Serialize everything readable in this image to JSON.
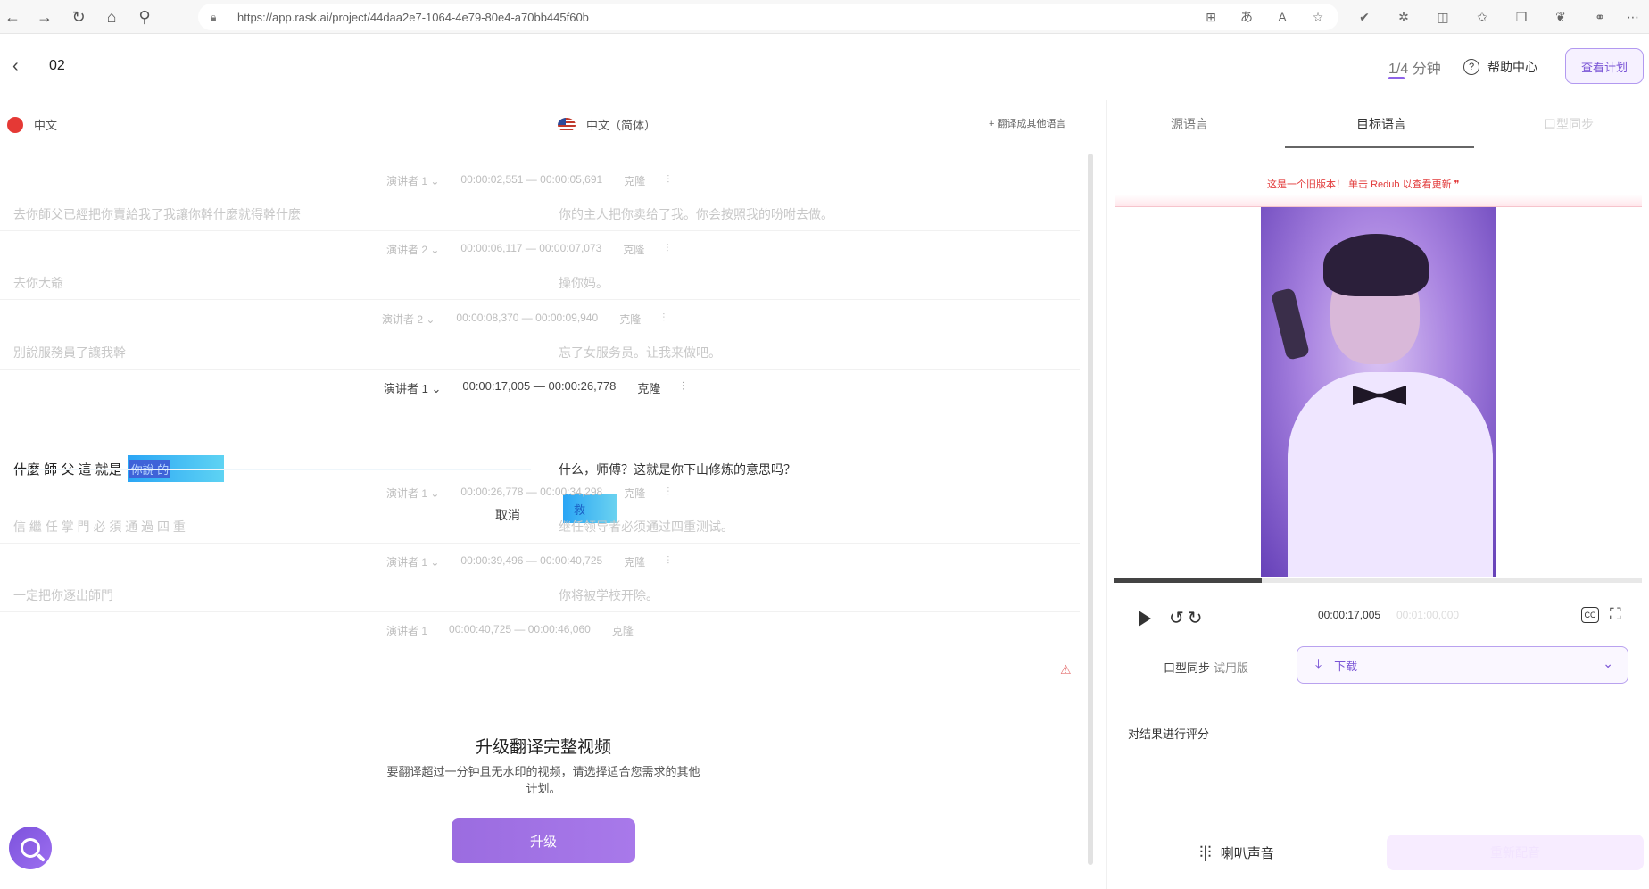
{
  "browser": {
    "url": "https://app.rask.ai/project/44daa2e7-1064-4e79-80e4-a70bb445f60b"
  },
  "header": {
    "project_title": "02",
    "minutes_used": "1/4 分钟",
    "help_label": "帮助中心",
    "plan_button": "查看计划"
  },
  "languages": {
    "source": "中文",
    "target": "中文（简体）",
    "translate_other": "+ 翻译成其他语言"
  },
  "segments": [
    {
      "speaker": "演讲者 1 ⌄",
      "time": "00:00:02,551 — 00:00:05,691",
      "clone": "克隆",
      "source": "去你師父已經把你賣給我了我讓你幹什麼就得幹什麼",
      "target": "你的主人把你卖给了我。你会按照我的吩咐去做。"
    },
    {
      "speaker": "演讲者 2 ⌄",
      "time": "00:00:06,117 — 00:00:07,073",
      "clone": "克隆",
      "source": "去你大爺",
      "target": "操你妈。"
    },
    {
      "speaker": "演讲者 2 ⌄",
      "time": "00:00:08,370 — 00:00:09,940",
      "clone": "克隆",
      "source": "別說服務員了讓我幹",
      "target": "忘了女服务员。让我来做吧。"
    },
    {
      "speaker": "演讲者 1 ⌄",
      "time": "00:00:26,778 — 00:00:34,298",
      "clone": "克隆",
      "source": "信 繼 任 掌 門 必 須 通 過 四 重",
      "target": "继任领导者必须通过四重测试。"
    },
    {
      "speaker": "演讲者 1 ⌄",
      "time": "00:00:39,496 — 00:00:40,725",
      "clone": "克隆",
      "source": "一定把你逐出師門",
      "target": "你将被学校开除。"
    },
    {
      "speaker": "演讲者 1",
      "time": "00:00:40,725 — 00:00:46,060",
      "clone": "克隆"
    }
  ],
  "active_segment": {
    "speaker": "演讲者 1 ⌄",
    "time": "00:00:17,005 — 00:00:26,778",
    "clone": "克隆",
    "source_text": "什麼 師 父 這 就是",
    "source_selected": "你說 的",
    "target": "什么，师傅？这就是你下山修炼的意思吗？",
    "cancel_label": "取消",
    "save_label": "救"
  },
  "upgrade": {
    "title": "升级翻译完整视频",
    "description": "要翻译超过一分钟且无水印的视频，请选择适合您需求的其他计划。",
    "button": "升级"
  },
  "right_panel": {
    "tabs": [
      "源语言",
      "目标语言",
      "口型同步"
    ],
    "active_tab_index": 1,
    "old_version_notice": "这是一个旧版本！ 单击 Redub 以查看更新 ❞",
    "current_time": "00:00:17,005",
    "duration": "00:01:00,000",
    "progress_fraction": 0.28,
    "lipsync_label": "口型同步",
    "lipsync_trial": "试用版",
    "download_label": "下载",
    "rate_label": "对结果进行评分",
    "voice_label": "喇叭声音",
    "dub_button": "重新配音"
  },
  "colors": {
    "accent": "#8d62e8",
    "warning": "#e23b3b",
    "highlight": "#2aa5f5"
  }
}
